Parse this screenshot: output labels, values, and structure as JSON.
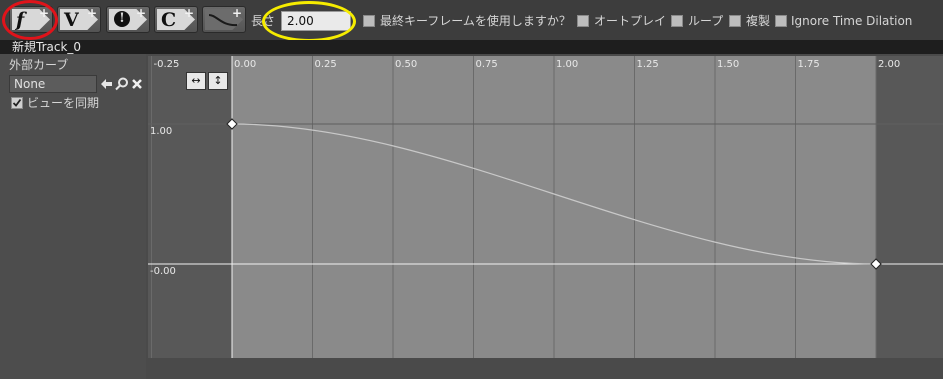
{
  "toolbar": {
    "buttons": [
      {
        "glyph": "f",
        "plus": "+"
      },
      {
        "glyph": "V",
        "plus": "+"
      },
      {
        "glyph": "!",
        "plus": "+"
      },
      {
        "glyph": "C",
        "plus": "+"
      },
      {
        "glyph": "",
        "plus": "+"
      }
    ],
    "length_label": "長さ",
    "length_value": "2.00",
    "options": [
      {
        "label": "最終キーフレームを使用しますか？",
        "checked": false
      },
      {
        "label": "オートプレイ",
        "checked": false
      },
      {
        "label": "ループ",
        "checked": false
      },
      {
        "label": "複製",
        "checked": false
      },
      {
        "label": "Ignore Time Dilation",
        "checked": false
      }
    ]
  },
  "track": {
    "name": "新規Track_0"
  },
  "sidebar": {
    "external_curve_label": "外部カーブ",
    "external_curve_value": "None",
    "sync_view_label": "ビューを同期",
    "sync_view_checked": true
  },
  "curve_editor": {
    "time_ticks": [
      "-0.25",
      "0.00",
      "0.25",
      "0.50",
      "0.75",
      "1.00",
      "1.25",
      "1.50",
      "1.75",
      "2.00"
    ],
    "value_labels": [
      "1.00",
      "-0.00"
    ],
    "keys": [
      {
        "time": 0.0,
        "value": 1.0
      },
      {
        "time": 2.0,
        "value": 0.0
      }
    ],
    "fit_horizontal_glyph": "↔",
    "fit_vertical_glyph": "↕"
  },
  "colors": {
    "annotation_red": "#e0131a",
    "annotation_yellow": "#f6ec00",
    "curve": "#c8c8c8"
  }
}
